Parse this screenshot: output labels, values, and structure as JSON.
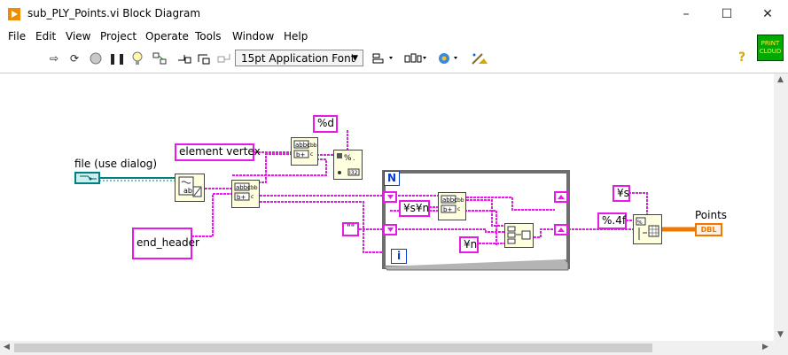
{
  "window": {
    "title": "sub_PLY_Points.vi Block Diagram",
    "minimize_icon": "–",
    "maximize_icon": "☐",
    "close_icon": "✕"
  },
  "menu": [
    "File",
    "Edit",
    "View",
    "Project",
    "Operate",
    "Tools",
    "Window",
    "Help"
  ],
  "toolbar": {
    "font_select": "15pt Application Font",
    "help_icon": "?",
    "connector_text": "PRINT CLOUD"
  },
  "diagram": {
    "file_label": "file (use dialog)",
    "element_vertex": "element vertex",
    "end_header": "end_header",
    "fmt_d": "%d",
    "fmt_s_n": "¥s¥n",
    "empty_string": "\"\"",
    "newline": "¥n",
    "fmt_s": "¥s",
    "fmt_4f": "%.4f",
    "points_label": "Points",
    "points_indicator": "DBL",
    "loop_n": "N",
    "loop_i": "i"
  },
  "colors": {
    "string_wire": "#e619e6",
    "path_wire": "#008080",
    "numeric_wire": "#f07800",
    "loop_border": "#6e6e6e"
  }
}
